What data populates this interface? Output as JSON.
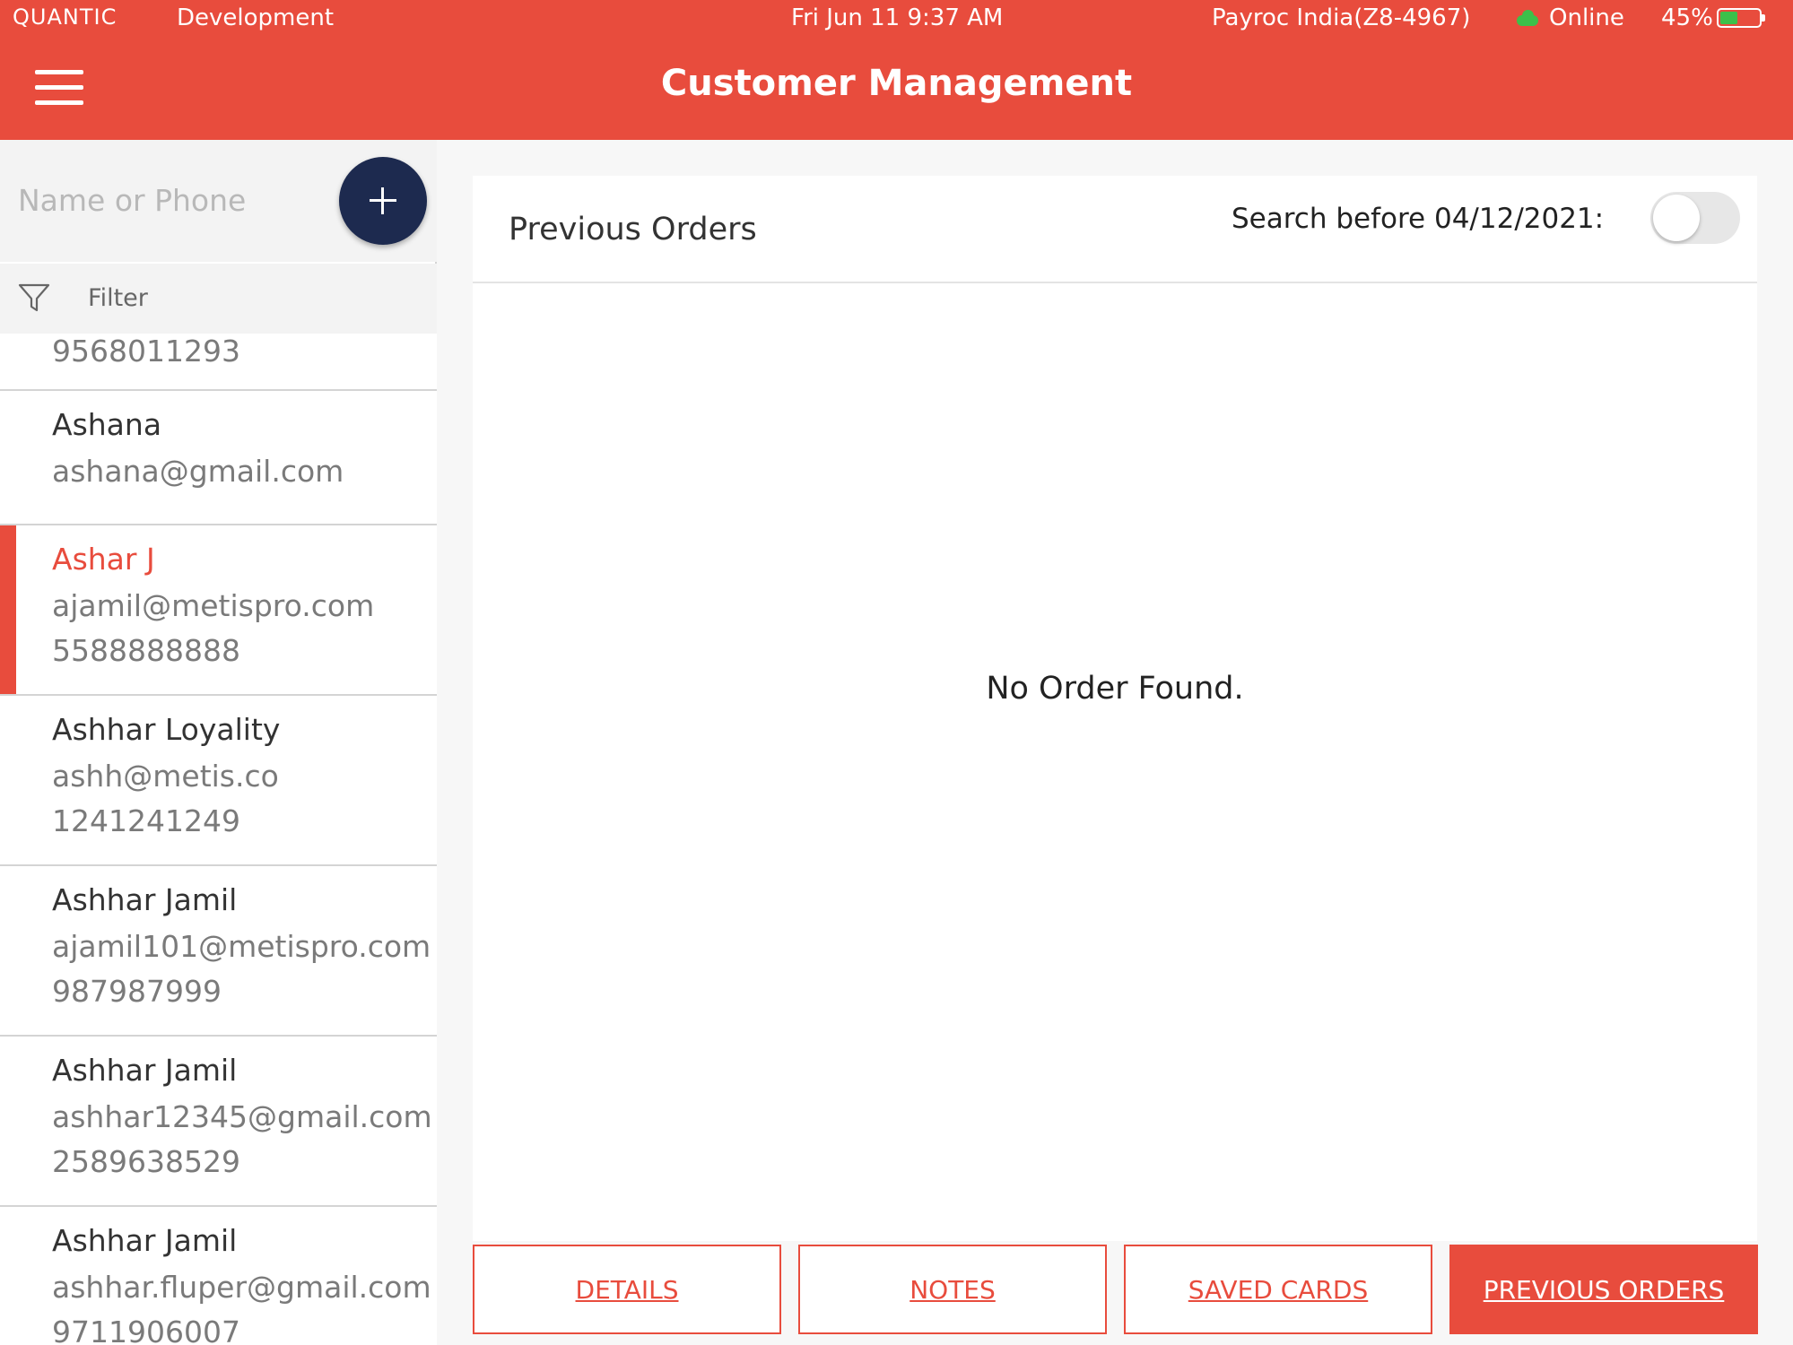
{
  "status_bar": {
    "brand": "QUANTIC",
    "environment": "Development",
    "datetime": "Fri Jun 11 9:37 AM",
    "store": "Payroc India(Z8-4967)",
    "connection": "Online",
    "battery": "45%",
    "battery_level": 0.45,
    "icons": [
      "cloud-icon",
      "battery-icon"
    ]
  },
  "header": {
    "title": "Customer Management",
    "menu_icon": "hamburger-menu-icon"
  },
  "sidebar": {
    "search_placeholder": "Name or Phone",
    "add_icon": "plus-icon",
    "filter_label": "Filter",
    "filter_icon": "funnel-icon",
    "customers": [
      {
        "name": "",
        "email": "",
        "phone": "9568011293",
        "selected": false
      },
      {
        "name": "Ashana",
        "email": "ashana@gmail.com",
        "phone": "",
        "selected": false
      },
      {
        "name": "Ashar J",
        "email": "ajamil@metispro.com",
        "phone": "5588888888",
        "selected": true
      },
      {
        "name": "Ashhar  Loyality",
        "email": "ashh@metis.co",
        "phone": "1241241249",
        "selected": false
      },
      {
        "name": "Ashhar Jamil",
        "email": "ajamil101@metispro.com",
        "phone": "987987999",
        "selected": false
      },
      {
        "name": "Ashhar Jamil",
        "email": "ashhar12345@gmail.com",
        "phone": "2589638529",
        "selected": false
      },
      {
        "name": "Ashhar Jamil",
        "email": "ashhar.fluper@gmail.com",
        "phone": "9711906007",
        "selected": false
      }
    ]
  },
  "main": {
    "section_title": "Previous Orders",
    "search_before_label": "Search before 04/12/2021:",
    "search_before_enabled": false,
    "empty_message": "No Order Found."
  },
  "tabs": [
    {
      "label": "DETAILS",
      "active": false
    },
    {
      "label": "NOTES",
      "active": false
    },
    {
      "label": "SAVED CARDS",
      "active": false
    },
    {
      "label": "PREVIOUS ORDERS",
      "active": true
    }
  ],
  "colors": {
    "accent": "#e84c3d",
    "fab": "#1d2a4f",
    "online": "#3cc04a"
  }
}
